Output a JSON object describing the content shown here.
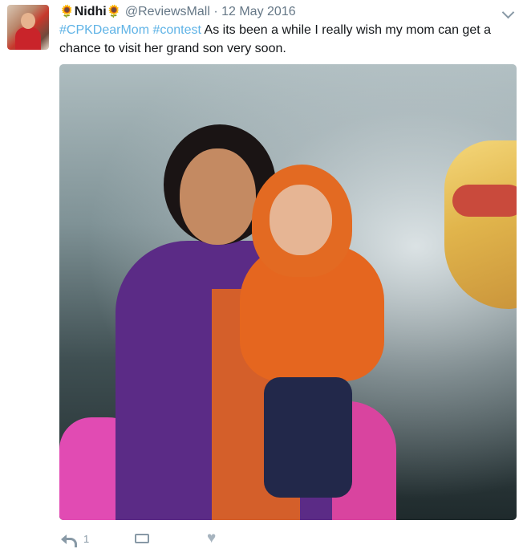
{
  "tweet": {
    "author_prefix_icon": "sunflower-emoji",
    "author_name": "Nidhi",
    "author_suffix_icon": "sunflower-emoji",
    "handle": "@ReviewsMall",
    "separator": "·",
    "date": "12 May 2016",
    "hashtag1": "#CPKDearMom",
    "hashtag2": "#contest",
    "body_line": "As its been a while I really wish my mom can get a chance to visit her grand son very soon."
  },
  "actions": {
    "reply_icon": "reply-icon",
    "reply_count": "1",
    "retweet_icon": "retweet-icon",
    "like_icon": "heart-icon"
  },
  "menu": {
    "icon": "chevron-down-icon"
  },
  "colors": {
    "hashtag": "#5fb3e6",
    "muted": "#657786",
    "icon": "#8899a6"
  }
}
